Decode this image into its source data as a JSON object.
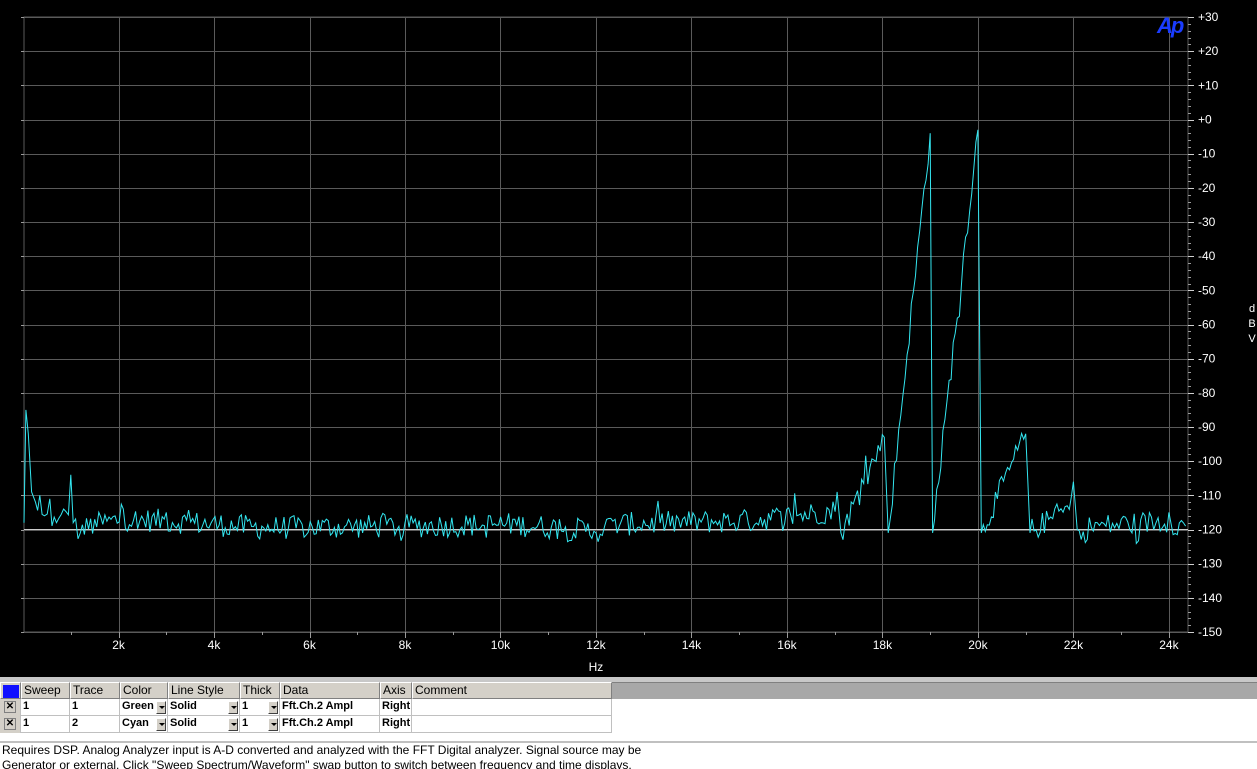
{
  "logo": "Ap",
  "y_unit_letters": [
    "d",
    "B",
    "V"
  ],
  "colors": {
    "background": "#000000",
    "grid": "#5a5a5a",
    "trace": "#33e6f0",
    "logo": "#1a3cff"
  },
  "chart_data": {
    "type": "line",
    "title": "",
    "xlabel": "Hz",
    "ylabel": "dBV",
    "xlim": [
      20,
      24400
    ],
    "ylim": [
      -150,
      30
    ],
    "grid": true,
    "x_ticks": [
      "2k",
      "4k",
      "6k",
      "8k",
      "10k",
      "12k",
      "14k",
      "16k",
      "18k",
      "20k",
      "22k",
      "24k"
    ],
    "x_tick_values": [
      2000,
      4000,
      6000,
      8000,
      10000,
      12000,
      14000,
      16000,
      18000,
      20000,
      22000,
      24000
    ],
    "y_ticks": [
      "+30",
      "+20",
      "+10",
      "+0",
      "-10",
      "-20",
      "-30",
      "-40",
      "-50",
      "-60",
      "-70",
      "-80",
      "-90",
      "-100",
      "-110",
      "-120",
      "-130",
      "-140",
      "-150"
    ],
    "y_tick_values": [
      30,
      20,
      10,
      0,
      -10,
      -20,
      -30,
      -40,
      -50,
      -60,
      -70,
      -80,
      -90,
      -100,
      -110,
      -120,
      -130,
      -140,
      -150
    ],
    "reference_line": -120,
    "series": [
      {
        "color": "#33e6f0",
        "noise_floor": -120,
        "points": [
          [
            20,
            -118
          ],
          [
            60,
            -85
          ],
          [
            110,
            -92
          ],
          [
            180,
            -109
          ],
          [
            260,
            -112
          ],
          [
            350,
            -110
          ],
          [
            450,
            -116
          ],
          [
            560,
            -111
          ],
          [
            700,
            -118
          ],
          [
            850,
            -114
          ],
          [
            1000,
            -104
          ],
          [
            1050,
            -118
          ],
          [
            1200,
            -121
          ],
          [
            1500,
            -117
          ],
          [
            2100,
            -114
          ],
          [
            3000,
            -115
          ],
          [
            5000,
            -119
          ],
          [
            8000,
            -118
          ],
          [
            10300,
            -117
          ],
          [
            12000,
            -121
          ],
          [
            12400,
            -117
          ],
          [
            13600,
            -116
          ],
          [
            15150,
            -115
          ],
          [
            17050,
            -109
          ],
          [
            17130,
            -121
          ],
          [
            18040,
            -93
          ],
          [
            18120,
            -121
          ],
          [
            19000,
            -4
          ],
          [
            19050,
            -121
          ],
          [
            20000,
            -3
          ],
          [
            20070,
            -121
          ],
          [
            21000,
            -92
          ],
          [
            21090,
            -121
          ],
          [
            22000,
            -106
          ],
          [
            22080,
            -120
          ],
          [
            22500,
            -118
          ],
          [
            23000,
            -117
          ],
          [
            23500,
            -116
          ],
          [
            24000,
            -115
          ],
          [
            24350,
            -119
          ]
        ]
      }
    ]
  },
  "table": {
    "headers": [
      "Sweep",
      "Trace",
      "Color",
      "Line Style",
      "Thick",
      "Data",
      "Axis",
      "Comment"
    ],
    "rows": [
      {
        "sweep": "1",
        "trace": "1",
        "color": "Green",
        "line_style": "Solid",
        "thick": "1",
        "data": "Fft.Ch.2 Ampl",
        "axis": "Right"
      },
      {
        "sweep": "1",
        "trace": "2",
        "color": "Cyan",
        "line_style": "Solid",
        "thick": "1",
        "data": "Fft.Ch.2 Ampl",
        "axis": "Right"
      }
    ]
  },
  "status": {
    "line1": "Requires DSP.  Analog Analyzer input is A-D converted and analyzed with the FFT Digital analyzer.  Signal source may be",
    "line2": "Generator or external.  Click \"Sweep Spectrum/Waveform\" swap button to switch between frequency and time displays."
  }
}
